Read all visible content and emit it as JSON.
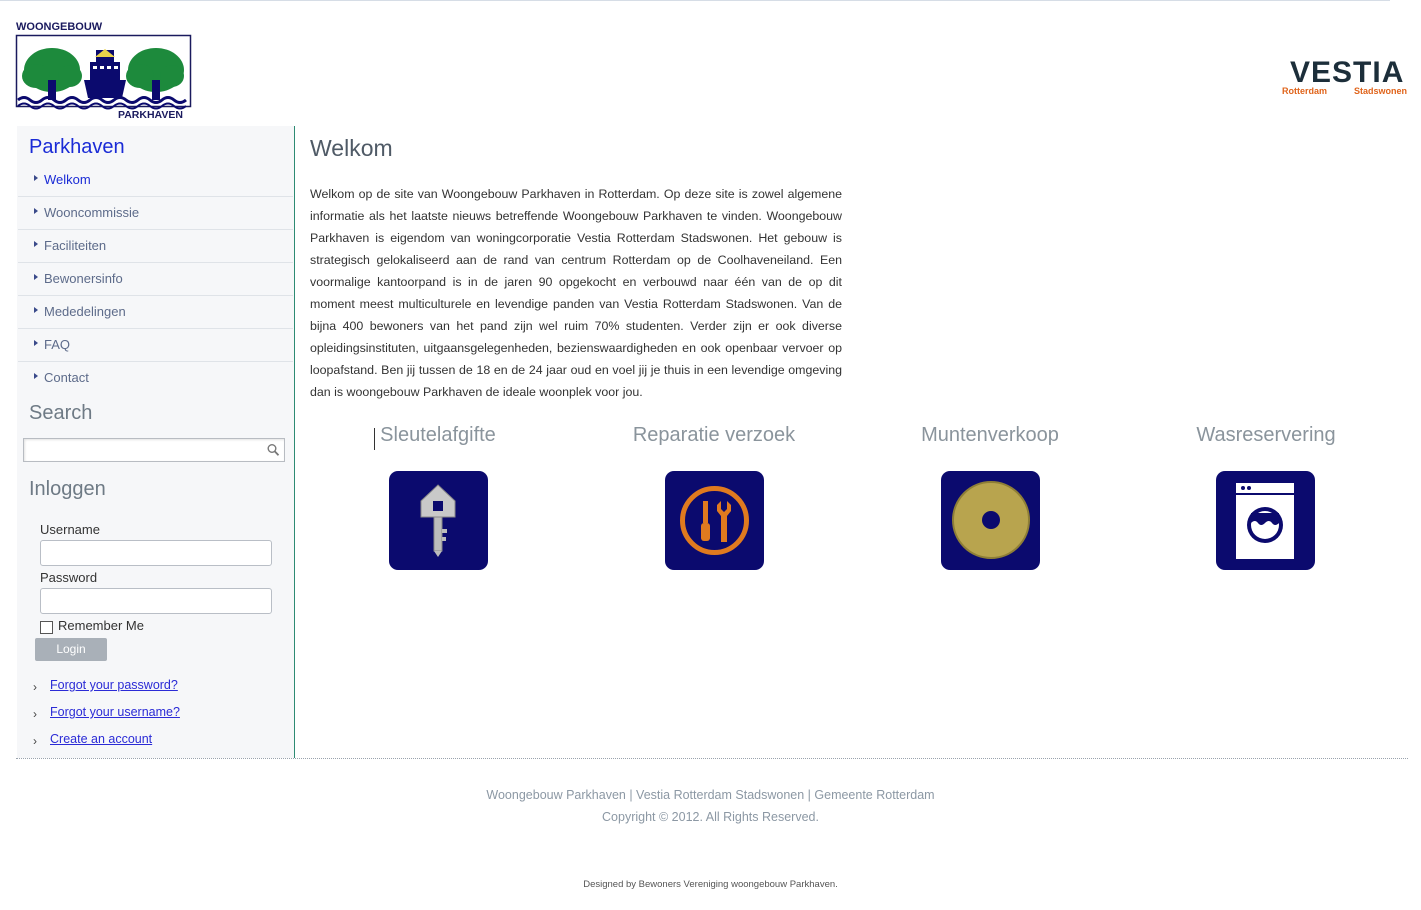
{
  "header": {
    "left_logo": {
      "name": "woongebouw-parkhaven-logo",
      "text_top": "WOONGEBOUW",
      "text_bottom": "PARKHAVEN"
    },
    "right_logo": {
      "name": "vestia-logo",
      "brand": "VESTIA",
      "sub_left": "Rotterdam",
      "sub_right": "Stadswonen"
    }
  },
  "sidebar": {
    "title": "Parkhaven",
    "items": [
      {
        "label": "Welkom",
        "active": true
      },
      {
        "label": "Wooncommissie",
        "active": false
      },
      {
        "label": "Faciliteiten",
        "active": false
      },
      {
        "label": "Bewonersinfo",
        "active": false
      },
      {
        "label": "Mededelingen",
        "active": false
      },
      {
        "label": "FAQ",
        "active": false
      },
      {
        "label": "Contact",
        "active": false
      }
    ],
    "search": {
      "title": "Search",
      "value": "",
      "icon": "magnifier-icon"
    },
    "login": {
      "title": "Inloggen",
      "username_label": "Username",
      "username_value": "",
      "password_label": "Password",
      "password_value": "",
      "remember_label": "Remember Me",
      "remember_checked": false,
      "button": "Login",
      "links": [
        "Forgot your password?",
        "Forgot your username?",
        "Create an account"
      ]
    }
  },
  "main": {
    "title": "Welkom",
    "intro": "Welkom op de site van Woongebouw Parkhaven in Rotterdam. Op deze site is zowel algemene informatie als het laatste nieuws betreffende Woongebouw Parkhaven te vinden. Woongebouw Parkhaven is eigendom van woningcorporatie Vestia Rotterdam Stadswonen. Het gebouw is strategisch gelokaliseerd aan de rand van centrum Rotterdam op de Coolhaveneiland. Een voormalige kantoorpand is in de jaren 90 opgekocht en verbouwd naar één van de op dit moment meest multiculturele en levendige panden van Vestia Rotterdam Stadswonen. Van de bijna 400 bewoners van het pand zijn wel ruim 70% studenten. Verder zijn er ook diverse opleidingsinstituten, uitgaansgelegenheden, bezienswaardigheden en ook openbaar vervoer op loopafstand. Ben jij tussen de 18 en de 24 jaar oud en voel jij je thuis in een levendige omgeving dan is woongebouw Parkhaven de ideale woonplek voor jou.",
    "tiles": [
      {
        "title": "Sleutelafgifte",
        "icon": "house-key-icon"
      },
      {
        "title": "Reparatie verzoek",
        "icon": "tools-icon"
      },
      {
        "title": "Muntenverkoop",
        "icon": "coin-icon"
      },
      {
        "title": "Wasreservering",
        "icon": "washing-machine-icon"
      }
    ]
  },
  "footer": {
    "links": "Woongebouw Parkhaven | Vestia Rotterdam Stadswonen | Gemeente Rotterdam",
    "copyright": "Copyright © 2012. All Rights Reserved.",
    "designed_by": "Designed by Bewoners Vereniging woongebouw Parkhaven."
  },
  "colors": {
    "accent_blue": "#1a2bd6",
    "tile_bg": "#0b0a6e",
    "logo_green": "#1d8a3c",
    "vestia_orange": "#e0641b",
    "divider_green": "#2e8b73"
  }
}
